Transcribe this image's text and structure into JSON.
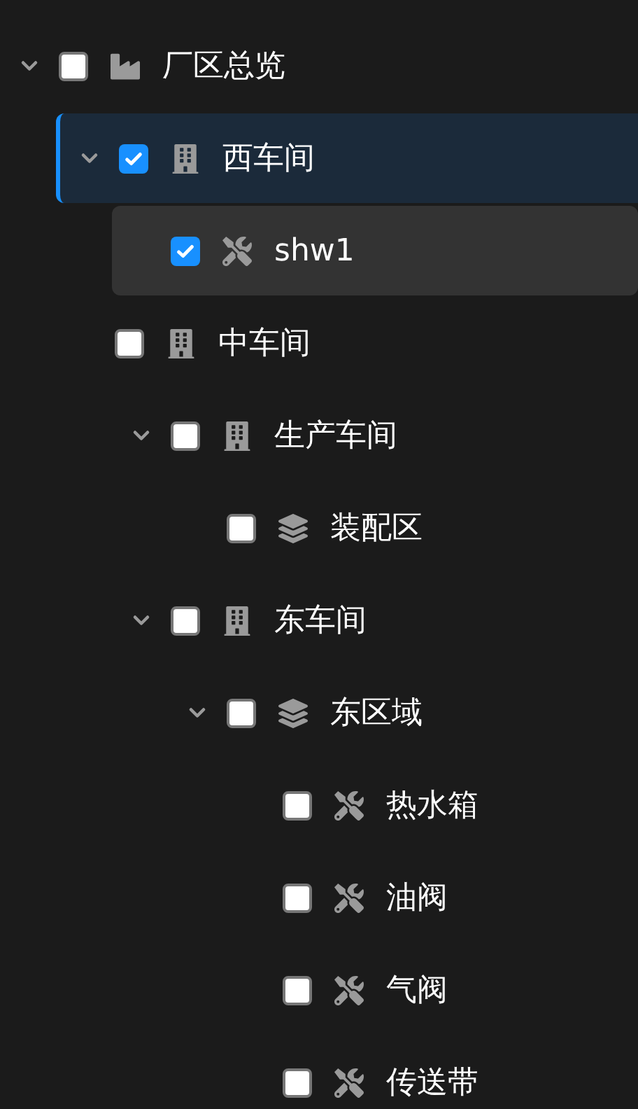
{
  "tree": [
    {
      "label": "厂区总览",
      "kind": "site",
      "checked": false,
      "expanded": true,
      "selected": false,
      "hovered": false,
      "children": [
        {
          "label": "西车间",
          "kind": "workshop",
          "checked": true,
          "expanded": true,
          "selected": true,
          "hovered": false,
          "children": [
            {
              "label": "shw1",
              "kind": "device",
              "checked": true,
              "selected": false,
              "hovered": true
            }
          ]
        },
        {
          "label": "中车间",
          "kind": "workshop",
          "checked": false,
          "selected": false,
          "hovered": false,
          "children": [
            {
              "label": "生产车间",
              "kind": "workshop",
              "checked": false,
              "expanded": true,
              "selected": false,
              "hovered": false,
              "children": [
                {
                  "label": "装配区",
                  "kind": "zone",
                  "checked": false,
                  "selected": false,
                  "hovered": false
                }
              ]
            },
            {
              "label": "东车间",
              "kind": "workshop",
              "checked": false,
              "expanded": true,
              "selected": false,
              "hovered": false,
              "children": [
                {
                  "label": "东区域",
                  "kind": "zone",
                  "checked": false,
                  "expanded": true,
                  "selected": false,
                  "hovered": false,
                  "children": [
                    {
                      "label": "热水箱",
                      "kind": "device",
                      "checked": false,
                      "selected": false,
                      "hovered": false
                    },
                    {
                      "label": "油阀",
                      "kind": "device",
                      "checked": false,
                      "selected": false,
                      "hovered": false
                    },
                    {
                      "label": "气阀",
                      "kind": "device",
                      "checked": false,
                      "selected": false,
                      "hovered": false
                    },
                    {
                      "label": "传送带",
                      "kind": "device",
                      "checked": false,
                      "selected": false,
                      "hovered": false
                    }
                  ]
                }
              ]
            }
          ]
        }
      ]
    }
  ]
}
